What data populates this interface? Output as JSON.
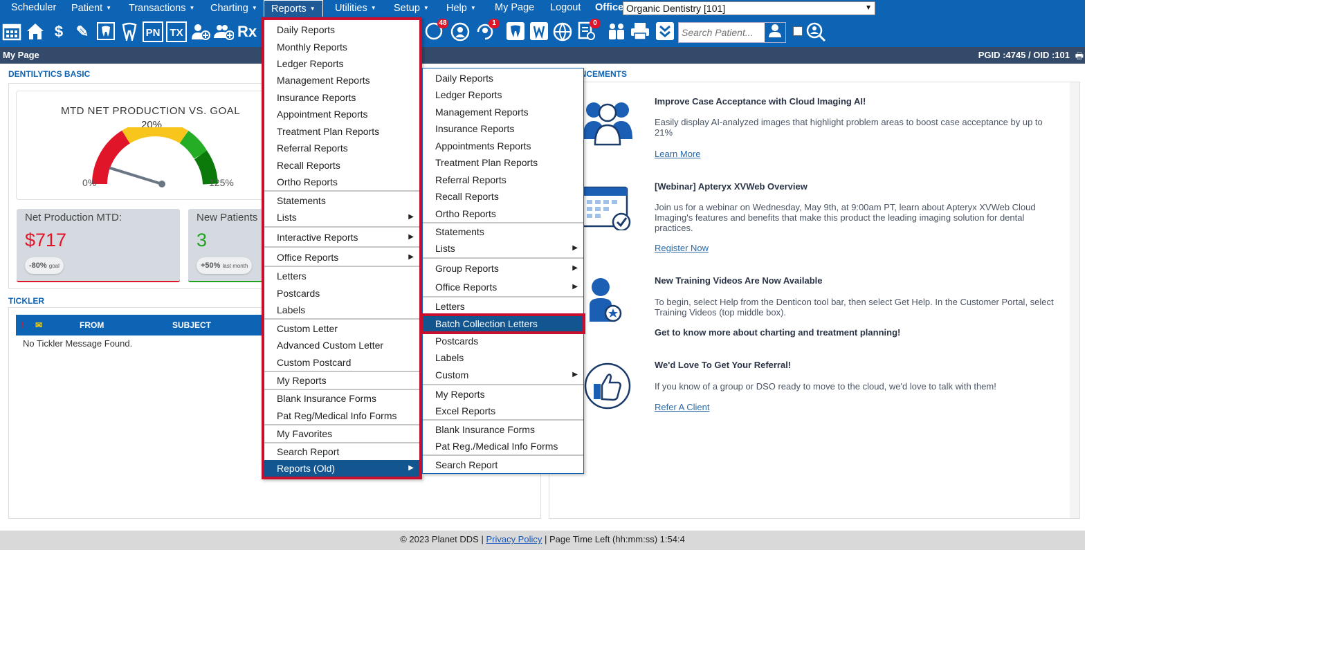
{
  "menubar": {
    "items": [
      "Scheduler",
      "Patient",
      "Transactions",
      "Charting",
      "Reports",
      "Utilities",
      "Setup",
      "Help",
      "My Page",
      "Logout"
    ],
    "office_label": "Office",
    "office_value": "Organic Dentistry [101]"
  },
  "toolbar": {
    "icons": [
      "calendar-icon",
      "home-icon",
      "dollar-icon",
      "pencil-icon",
      "tooth-chart-icon",
      "tooth-icon",
      "pn-icon",
      "tx-icon",
      "add-patient-icon",
      "add-group-icon",
      "rx-icon",
      "messages-icon",
      "support-icon",
      "sync-icon",
      "tooth-2-icon",
      "tooth-w-icon",
      "globe-icon",
      "document-check-icon",
      "family-icon",
      "printer-icon",
      "collapse-icon",
      "patient-search-icon",
      "multi-search-icon"
    ],
    "badge_messages": "48",
    "badge_sync": "1",
    "badge_doc": "0",
    "tx_text": "TX",
    "pn_text": "PN",
    "rx_text": "Rx",
    "search_placeholder": "Search Patient..."
  },
  "header": {
    "title": "My Page",
    "ids": "PGID :4745  /  OID :101"
  },
  "dentilytics": {
    "section_title": "DENTILYTICS BASIC",
    "gauge_title": "MTD NET PRODUCTION VS. GOAL",
    "gauge_percent": "20%",
    "gauge_min": "0%",
    "gauge_max": "125%",
    "gauge_value_fraction": 0.16,
    "kpis": [
      {
        "label": "Net Production MTD:",
        "value": "$717",
        "chip": "-80%",
        "chip_sub": "goal",
        "color": "#e0152a"
      },
      {
        "label": "New Patients",
        "value": "3",
        "chip": "+50%",
        "chip_sub": "last month",
        "color": "#1fa31f"
      }
    ]
  },
  "tickler": {
    "section_title": "TICKLER",
    "flag": "!",
    "col_from": "FROM",
    "col_subject": "SUBJECT",
    "empty": "No Tickler Message Found."
  },
  "announcements": {
    "section_title": "ANNOUNCEMENTS",
    "items": [
      {
        "title": "Improve Case Acceptance with Cloud Imaging AI!",
        "body": "Easily display AI-analyzed images that highlight problem areas to boost case acceptance by up to 21%",
        "link": "Learn More"
      },
      {
        "title": "[Webinar] Apteryx XVWeb Overview",
        "body": "Join us for a webinar on Wednesday, May 9th, at 9:00am PT, learn about Apteryx XVWeb Cloud Imaging's features and benefits that make this product the leading imaging solution for dental practices.",
        "link": "Register Now"
      },
      {
        "title": "New Training Videos Are Now Available",
        "body": "To begin, select Help from the Denticon tool bar, then select Get Help. In the Customer Portal, select Training Videos (top middle box).",
        "link": "Get to know more about charting and treatment planning!"
      },
      {
        "title": "We'd Love To Get Your Referral!",
        "body": "If you know of a group or DSO ready to move to the cloud, we'd love to talk with them!",
        "link": "Refer A Client"
      }
    ]
  },
  "reports_menu": {
    "items": [
      "Daily Reports",
      "Monthly Reports",
      "Ledger Reports",
      "Management Reports",
      "Insurance Reports",
      "Appointment Reports",
      "Treatment Plan Reports",
      "Referral Reports",
      "Recall Reports",
      "Ortho Reports",
      "Statements",
      "Lists",
      "Interactive Reports",
      "Office Reports",
      "Letters",
      "Postcards",
      "Labels",
      "Custom Letter",
      "Advanced Custom Letter",
      "Custom Postcard",
      "My Reports",
      "Blank Insurance Forms",
      "Pat Reg/Medical Info Forms",
      "My Favorites",
      "Search Report",
      "Reports (Old)"
    ]
  },
  "sub_menu": {
    "items": [
      "Daily Reports",
      "Ledger Reports",
      "Management Reports",
      "Insurance Reports",
      "Appointments Reports",
      "Treatment Plan Reports",
      "Referral Reports",
      "Recall Reports",
      "Ortho Reports",
      "Statements",
      "Lists",
      "Group Reports",
      "Office Reports",
      "Letters",
      "Batch Collection Letters",
      "Postcards",
      "Labels",
      "Custom",
      "My Reports",
      "Excel Reports",
      "Blank Insurance Forms",
      "Pat Reg./Medical Info Forms",
      "Search Report"
    ]
  },
  "footer": {
    "copyright": "© 2023 Planet DDS |",
    "privacy": "Privacy Policy",
    "time_left": "|  Page Time Left (hh:mm:ss) 1:54:4"
  },
  "colors": {
    "brand_blue": "#0d63b4",
    "highlight_red": "#c8102e",
    "menu_selected": "#12558f"
  }
}
